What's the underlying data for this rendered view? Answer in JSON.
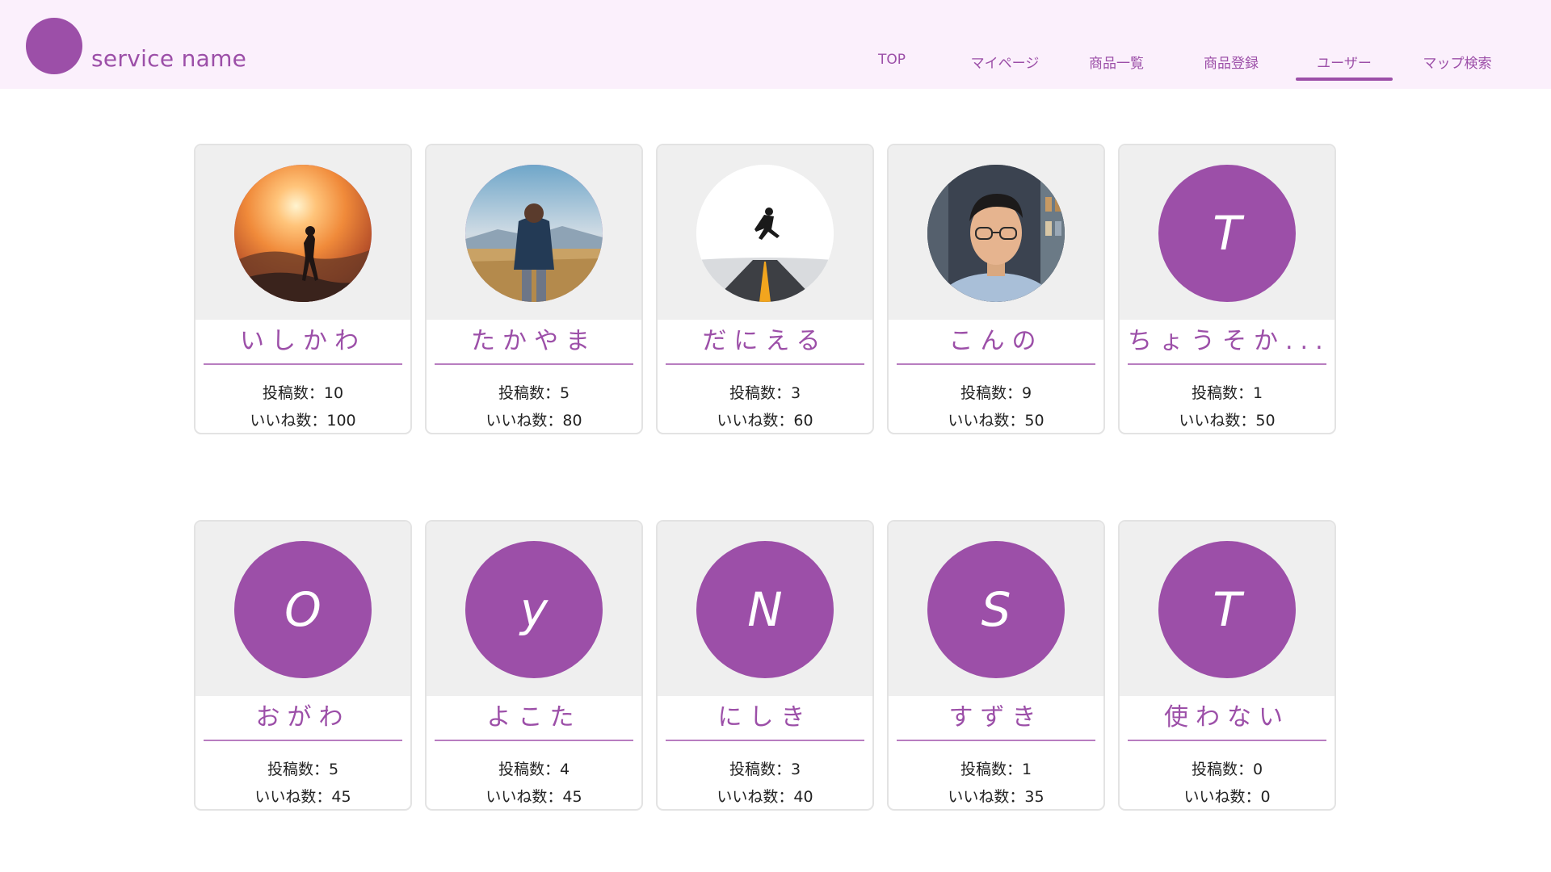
{
  "header": {
    "service_name": "service name",
    "nav": [
      {
        "label": "TOP",
        "active": false
      },
      {
        "label": "マイページ",
        "active": false
      },
      {
        "label": "商品一覧",
        "active": false
      },
      {
        "label": "商品登録",
        "active": false
      },
      {
        "label": "ユーザー",
        "active": true
      },
      {
        "label": "マップ検索",
        "active": false
      }
    ]
  },
  "users": [
    {
      "name": "いしかわ",
      "avatar": "photo-sunset-silhouette",
      "initial": "",
      "posts": "投稿数：10",
      "likes": "いいね数：100"
    },
    {
      "name": "たかやま",
      "avatar": "photo-man-in-field",
      "initial": "",
      "posts": "投稿数：5",
      "likes": "いいね数：80"
    },
    {
      "name": "だにえる",
      "avatar": "photo-jumping-on-road",
      "initial": "",
      "posts": "投稿数：3",
      "likes": "いいね数：60"
    },
    {
      "name": "こんの",
      "avatar": "photo-man-with-glasses",
      "initial": "",
      "posts": "投稿数：9",
      "likes": "いいね数：50"
    },
    {
      "name": "ちょうそか...",
      "avatar": "initial",
      "initial": "T",
      "posts": "投稿数：1",
      "likes": "いいね数：50"
    },
    {
      "name": "おがわ",
      "avatar": "initial",
      "initial": "O",
      "posts": "投稿数：5",
      "likes": "いいね数：45"
    },
    {
      "name": "よこた",
      "avatar": "initial",
      "initial": "y",
      "posts": "投稿数：4",
      "likes": "いいね数：45"
    },
    {
      "name": "にしき",
      "avatar": "initial",
      "initial": "N",
      "posts": "投稿数：3",
      "likes": "いいね数：40"
    },
    {
      "name": "すずき",
      "avatar": "initial",
      "initial": "S",
      "posts": "投稿数：1",
      "likes": "いいね数：35"
    },
    {
      "name": "使わない",
      "avatar": "initial",
      "initial": "T",
      "posts": "投稿数：0",
      "likes": "いいね数：0"
    }
  ],
  "colors": {
    "accent": "#9c4fa8",
    "header_bg": "#fbf0fc",
    "card_top": "#efefef"
  }
}
